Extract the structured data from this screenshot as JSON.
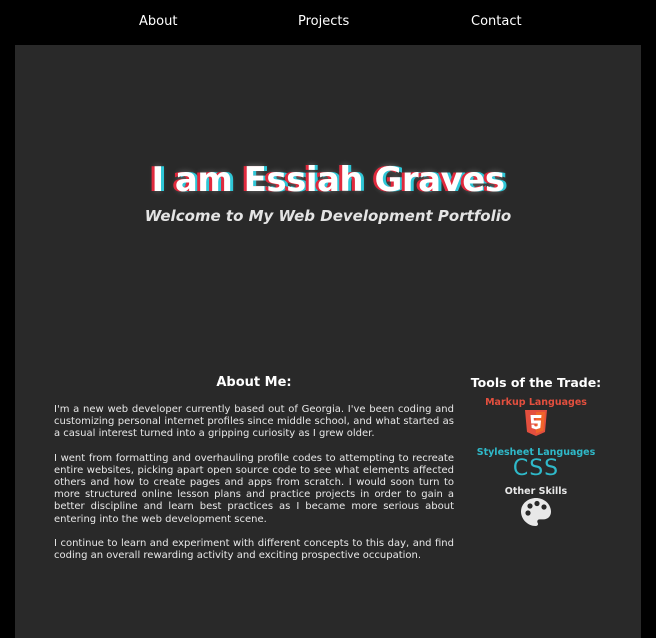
{
  "nav": {
    "about": "About",
    "projects": "Projects",
    "contact": "Contact"
  },
  "hero": {
    "title": "I am Essiah Graves",
    "subtitle": "Welcome to My Web Development Portfolio"
  },
  "about": {
    "heading": "About Me:",
    "paragraphs": [
      "I'm a new web developer currently based out of Georgia. I've been coding and customizing personal internet profiles since middle school, and what started as a casual interest turned into a gripping curiosity as I grew older.",
      "I went from formatting and overhauling profile codes to attempting to recreate entire websites, picking apart open source code to see what elements affected others and how to create pages and apps from scratch. I would soon turn to more structured online lesson plans and practice projects in order to gain a better discipline and learn best practices as I became more serious about entering into the web development scene.",
      "I continue to learn and experiment with different concepts to this day, and find coding an overall rewarding activity and exciting prospective occupation."
    ]
  },
  "tools": {
    "heading": "Tools of the Trade:",
    "markup_label": "Markup Languages",
    "stylesheet_label": "Stylesheet Languages",
    "css_logo_text": "CSS",
    "other_label": "Other Skills",
    "colors": {
      "markup": "#e34f3e",
      "stylesheet": "#2fb9c9",
      "other": "#e8e8e8"
    },
    "icons": [
      "html5-icon",
      "css3-icon",
      "palette-icon"
    ]
  },
  "colors": {
    "background": "#000000",
    "panel": "#292929",
    "title_glitch_red": "#e0293d",
    "title_glitch_cyan": "#2fc6d6"
  }
}
